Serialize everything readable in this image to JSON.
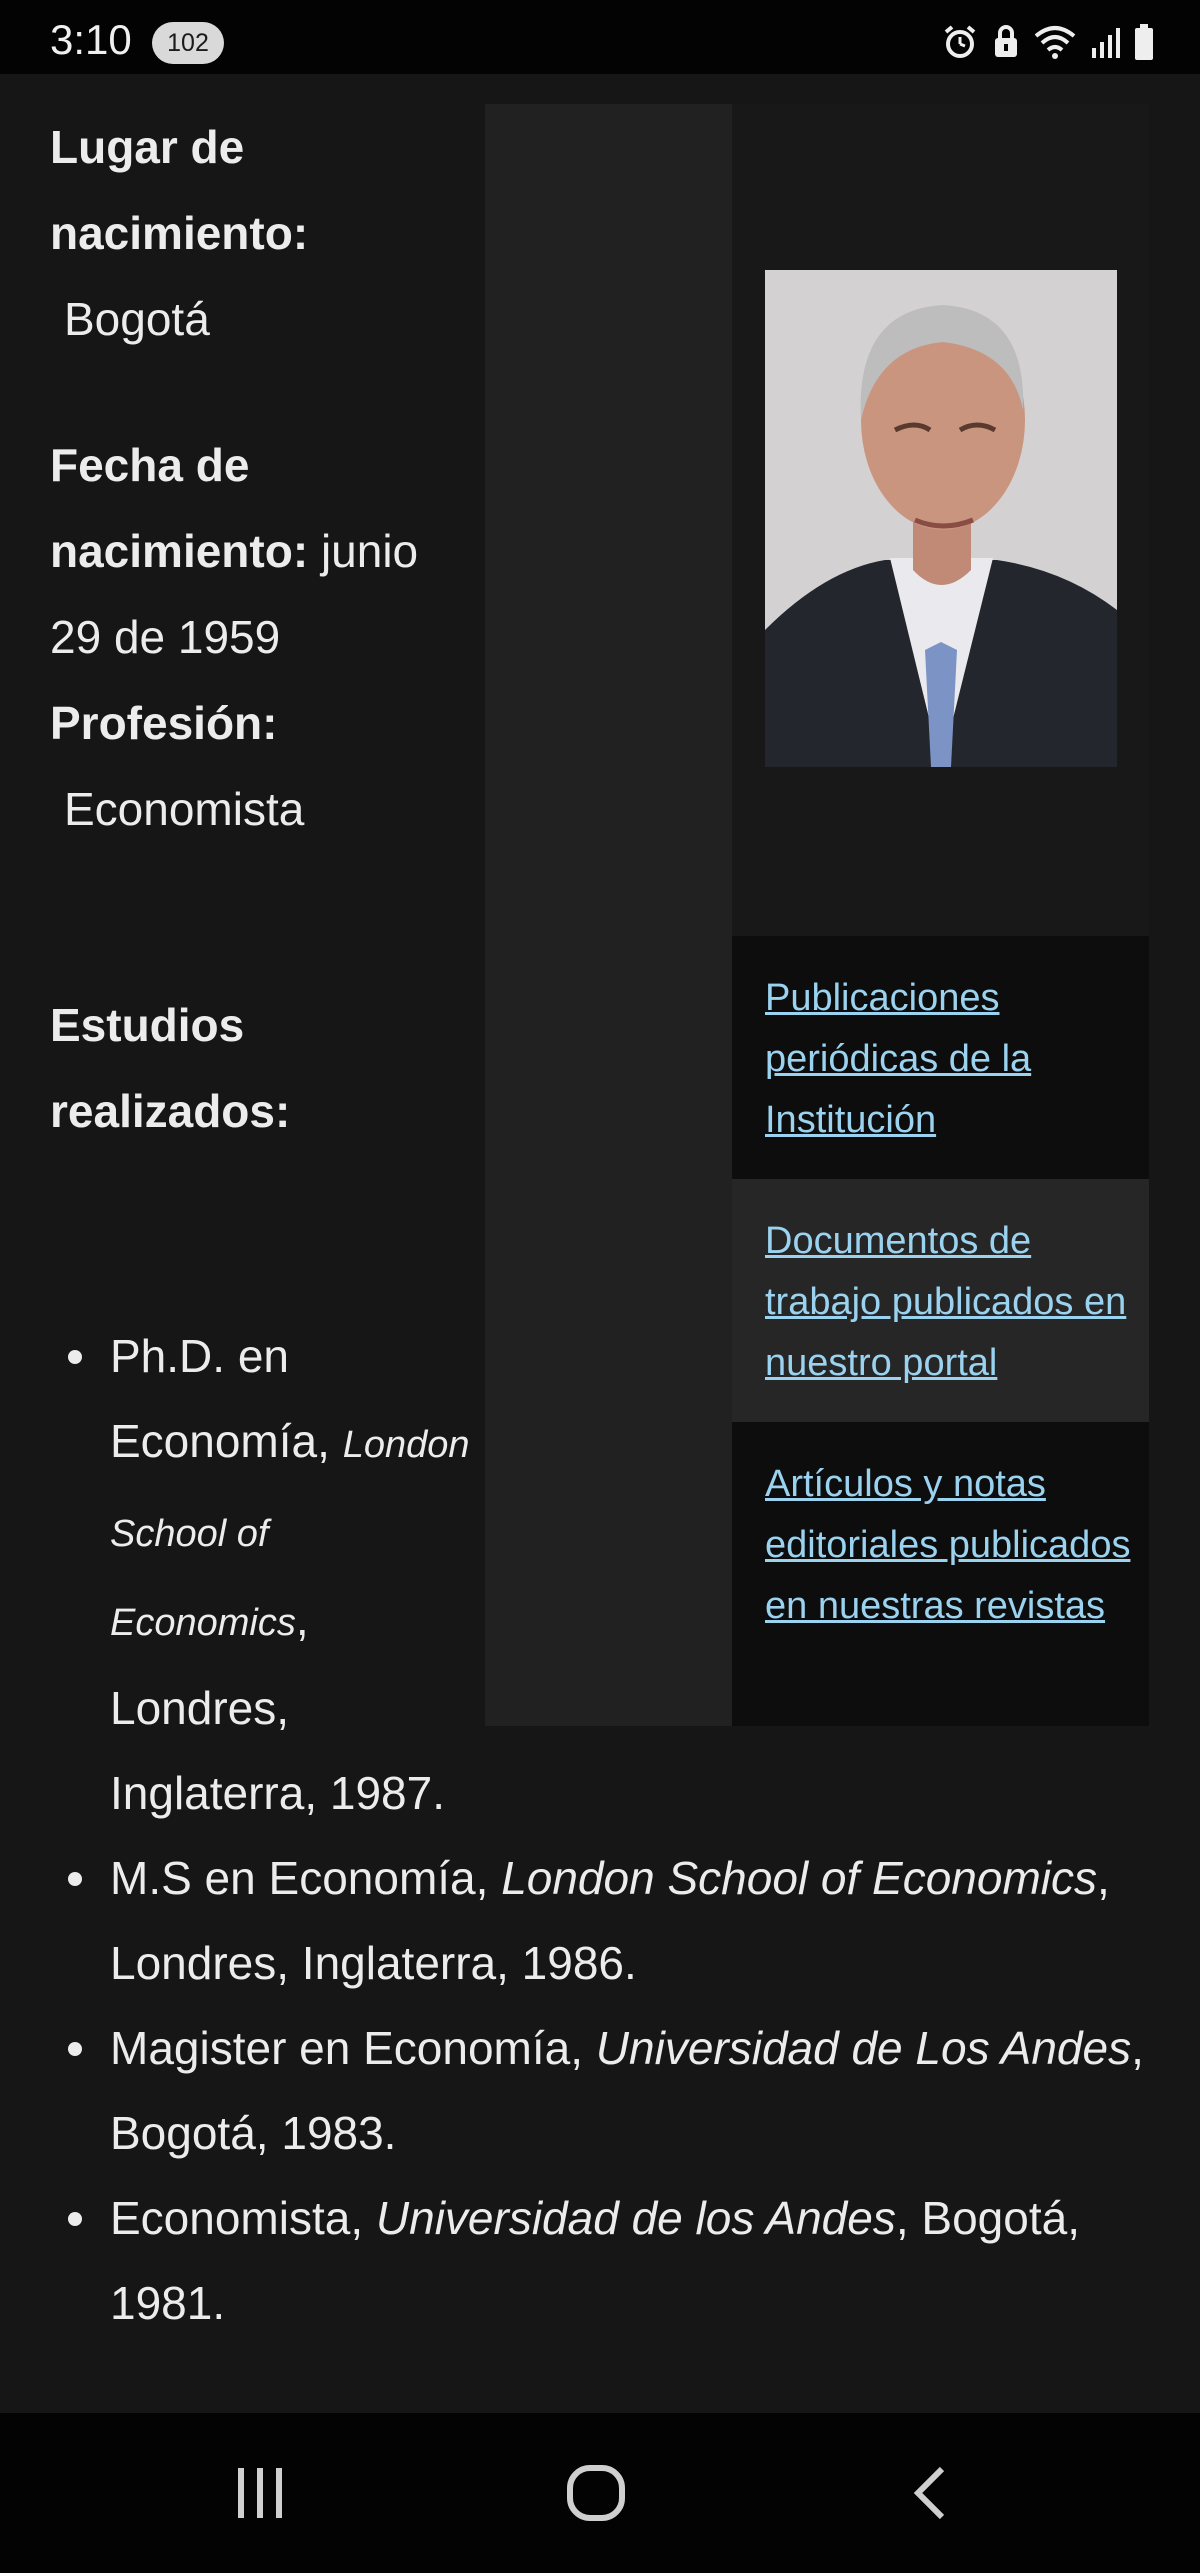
{
  "status_bar": {
    "time": "3:10",
    "notification_count": "102",
    "icons": [
      "alarm-icon",
      "lock-icon",
      "wifi-icon",
      "signal-icon",
      "battery-icon"
    ]
  },
  "profile": {
    "birthplace_label": "Lugar de nacimiento:",
    "birthplace_value": "Bogotá",
    "birthdate_label": "Fecha de nacimiento:",
    "birthdate_value": "junio 29 de 1959",
    "profession_label": "Profesión:",
    "profession_value": "Economista",
    "studies_label": "Estudios realizados:"
  },
  "studies": [
    {
      "degree": "Ph.D. en Economía,",
      "institution": "London School of Economics",
      "place": ", Londres, Inglaterra, 1987."
    },
    {
      "degree": "M.S en Economía, ",
      "institution": "London School of Economics",
      "place": ", Londres, Inglaterra, 1986."
    },
    {
      "degree": "Magister en Economía, ",
      "institution": "Universidad de Los Andes",
      "place": ", Bogotá, 1983."
    },
    {
      "degree": "Economista, ",
      "institution": "Universidad de los Andes",
      "place": ", Bogotá, 1981."
    }
  ],
  "links": [
    {
      "label": "Publicaciones periódicas de la Institución "
    },
    {
      "label": "Documentos de trabajo publicados en nuestro portal"
    },
    {
      "label": "Artículos y notas editoriales publicados en nuestras revistas"
    }
  ],
  "colors": {
    "background": "#161616",
    "link": "#9ad2ef",
    "status_bar": "#030303"
  },
  "navigation": {
    "icons": [
      "recent-apps-icon",
      "home-icon",
      "back-icon"
    ]
  }
}
